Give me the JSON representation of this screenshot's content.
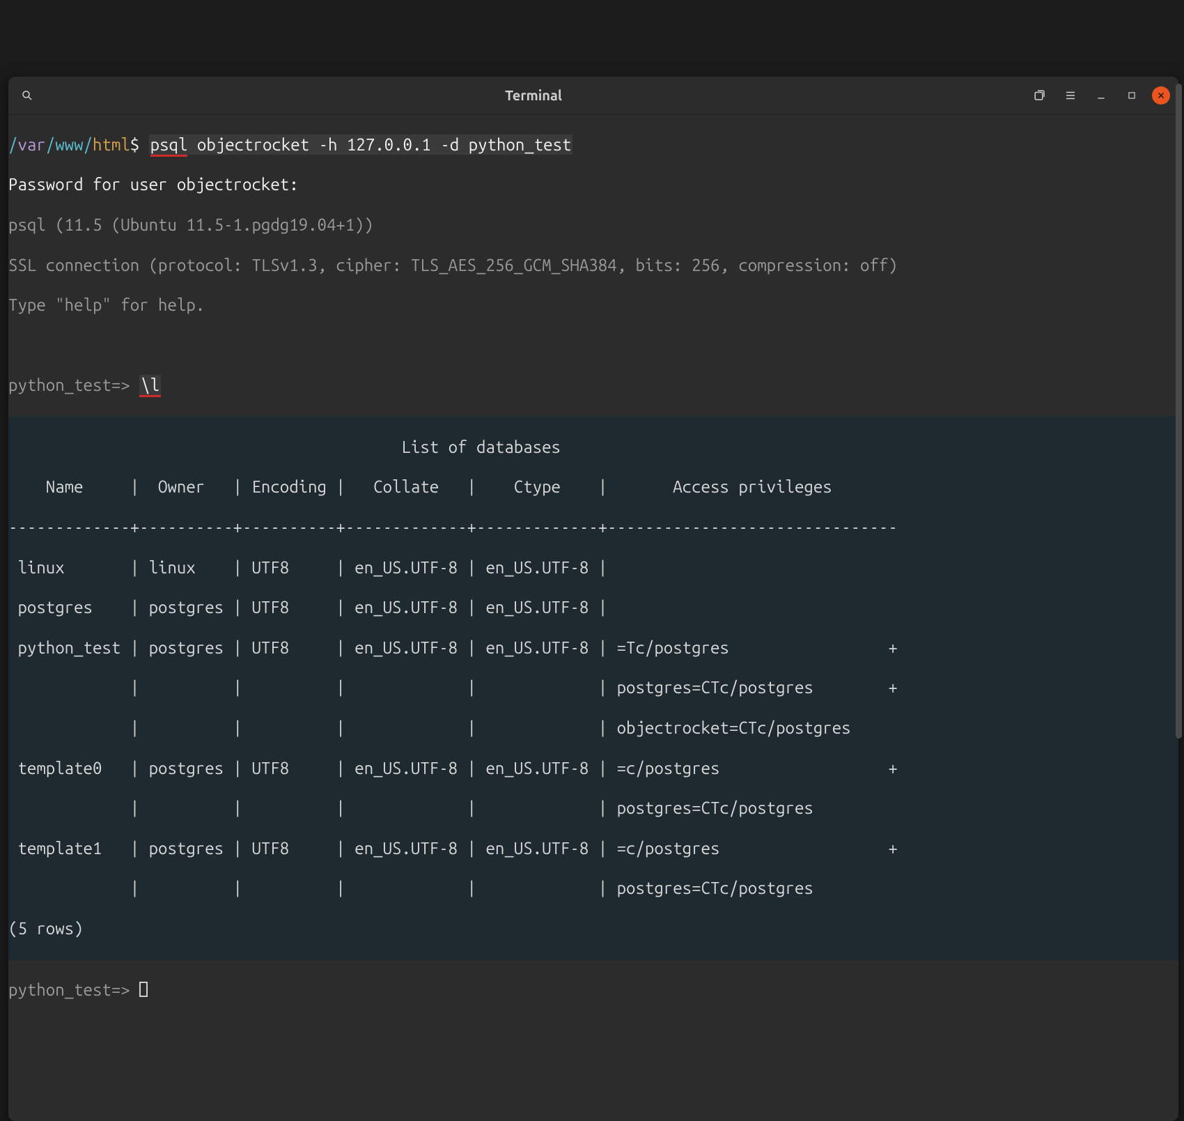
{
  "window": {
    "title": "Terminal"
  },
  "prompt": {
    "path_seg0": "/",
    "path_seg1": "var",
    "path_seg2": "/",
    "path_seg3": "www",
    "path_seg4": "/",
    "path_seg5": "html",
    "dollar": "$ ",
    "cmd_psql": "psql",
    "cmd_rest": " objectrocket -h 127.0.0.1 -d python_test"
  },
  "output": {
    "password_line": "Password for user objectrocket:",
    "version_line": "psql (11.5 (Ubuntu 11.5-1.pgdg19.04+1))",
    "ssl_line": "SSL connection (protocol: TLSv1.3, cipher: TLS_AES_256_GCM_SHA384, bits: 256, compression: off)",
    "help_line": "Type \"help\" for help."
  },
  "psql": {
    "prompt1": "python_test=> ",
    "cmd_l": "\\l",
    "prompt2": "python_test=> "
  },
  "table": {
    "title": "                                          List of databases",
    "header": "    Name     |  Owner   | Encoding |   Collate   |    Ctype    |       Access privileges       ",
    "divider": "-------------+----------+----------+-------------+-------------+-------------------------------",
    "rows": [
      " linux       | linux    | UTF8     | en_US.UTF-8 | en_US.UTF-8 | ",
      " postgres    | postgres | UTF8     | en_US.UTF-8 | en_US.UTF-8 | ",
      " python_test | postgres | UTF8     | en_US.UTF-8 | en_US.UTF-8 | =Tc/postgres                 +",
      "             |          |          |             |             | postgres=CTc/postgres        +",
      "             |          |          |             |             | objectrocket=CTc/postgres",
      " template0   | postgres | UTF8     | en_US.UTF-8 | en_US.UTF-8 | =c/postgres                  +",
      "             |          |          |             |             | postgres=CTc/postgres",
      " template1   | postgres | UTF8     | en_US.UTF-8 | en_US.UTF-8 | =c/postgres                  +",
      "             |          |          |             |             | postgres=CTc/postgres"
    ],
    "rowcount": "(5 rows)"
  }
}
